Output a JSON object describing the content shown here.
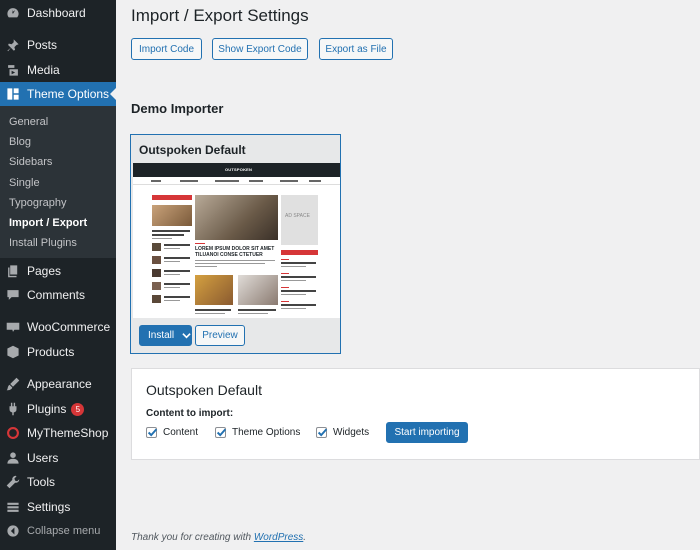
{
  "sidebar": {
    "dashboard": "Dashboard",
    "posts": "Posts",
    "media": "Media",
    "theme_options": "Theme Options",
    "sub": [
      "General",
      "Blog",
      "Sidebars",
      "Single",
      "Typography",
      "Import / Export",
      "Install Plugins"
    ],
    "pages": "Pages",
    "comments": "Comments",
    "woocommerce": "WooCommerce",
    "products": "Products",
    "appearance": "Appearance",
    "plugins": "Plugins",
    "plugins_badge": "5",
    "mythemeshop": "MyThemeShop",
    "users": "Users",
    "tools": "Tools",
    "settings": "Settings",
    "collapse": "Collapse menu"
  },
  "main": {
    "title": "Import / Export Settings",
    "buttons": {
      "import_code": "Import Code",
      "show_export_code": "Show Export Code",
      "export_as_file": "Export as File"
    },
    "demo_importer_title": "Demo Importer",
    "demo": {
      "name": "Outspoken Default",
      "thumb_logo": "OUTSPOKEN",
      "thumb_headline": "LOREM IPSUM DOLOR SIT AMET TILUANOI CONSE CTETUER",
      "thumb_ad": "AD SPACE",
      "install_label": "Install",
      "preview_label": "Preview"
    },
    "import_panel": {
      "title": "Outspoken Default",
      "content_label": "Content to import:",
      "options": [
        "Content",
        "Theme Options",
        "Widgets"
      ],
      "start_button": "Start importing"
    },
    "footer_prefix": "Thank you for creating with ",
    "footer_link": "WordPress",
    "footer_suffix": "."
  },
  "colors": {
    "sidebar_bg": "#1d2327",
    "submenu_bg": "#2c3338",
    "accent": "#2271b1",
    "badge": "#d63638",
    "page_bg": "#f0f0f1"
  }
}
